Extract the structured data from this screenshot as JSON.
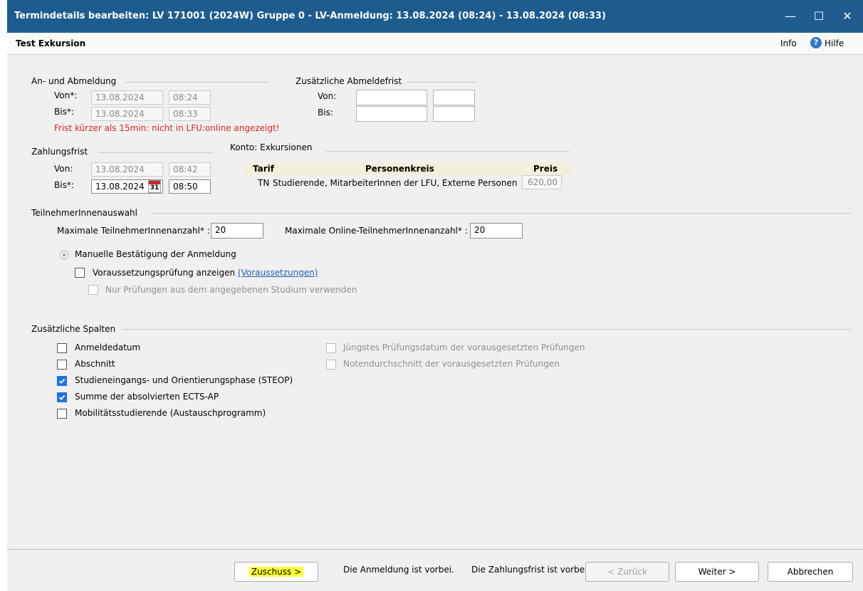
{
  "window": {
    "title": "Termindetails  bearbeiten:  LV 171001 (2024W)  Gruppe 0 - LV-Anmeldung: 13.08.2024 (08:24) - 13.08.2024 (08:33)",
    "minimize": "—",
    "maximize": "☐",
    "close": "✕",
    "bg_color": "#1e5b8e"
  },
  "header": {
    "title": "Test Exkursion",
    "info": "Info",
    "help": "Hilfe",
    "help_icon_glyph": "?"
  },
  "anmeldung": {
    "group_label": "An- und Abmeldung",
    "von_label": "Von*:",
    "von_date": "13.08.2024",
    "von_time": "08:24",
    "bis_label": "Bis*:",
    "bis_date": "13.08.2024",
    "bis_time": "08:33",
    "warning": "Frist kürzer als 15min: nicht in LFU:online angezeigt!"
  },
  "abmeldefrist": {
    "group_label": "Zusätzliche Abmeldefrist",
    "von_label": "Von:",
    "bis_label": "Bis:"
  },
  "zahlungsfrist": {
    "group_label": "Zahlungsfrist",
    "von_label": "Von:",
    "von_date": "13.08.2024",
    "von_time": "08:42",
    "bis_label": "Bis*:",
    "bis_date": "13.08.2024",
    "bis_time": "08:50",
    "calendar_day": "31"
  },
  "konto": {
    "label": "Konto: Exkursionen",
    "col_tarif": "Tarif",
    "col_personenkreis": "Personenkreis",
    "col_preis": "Preis",
    "row_tarif": "TN",
    "row_personenkreis": "Studierende, MitarbeiterInnen der LFU, Externe Personen",
    "row_preis": "620,00"
  },
  "teilnehmer": {
    "group_label": "TeilnehmerInnenauswahl",
    "max_label": "Maximale TeilnehmerInnenanzahl* :",
    "max_value": "20",
    "max_online_label": "Maximale Online-TeilnehmerInnenanzahl* :",
    "max_online_value": "20",
    "manual_label": "Manuelle Bestätigung der Anmeldung",
    "vorauss_label": "Voraussetzungsprüfung anzeigen",
    "vorauss_link": "(Voraussetzungen)",
    "nur_label": "Nur Prüfungen aus dem angegebenen Studium verwenden"
  },
  "spalten": {
    "group_label": "Zusätzliche Spalten",
    "anmeldedatum": "Anmeldedatum",
    "abschnitt": "Abschnitt",
    "steop": "Studieneingangs- und Orientierungsphase (STEOP)",
    "ects": "Summe der absolvierten ECTS-AP",
    "mobil": "Mobilitätsstudierende (Austauschprogramm)",
    "juengstes": "Jüngstes Prüfungsdatum der vorausgesetzten Prüfungen",
    "noten": "Notendurchschnitt der vorausgesetzten Prüfungen"
  },
  "footer": {
    "zuschuss": "Zuschuss >",
    "msg_anmeldung": "Die Anmeldung ist vorbei.",
    "msg_zahlung": "Die Zahlungsfrist ist vorbei.",
    "zurueck": "< Zurück",
    "weiter": "Weiter >",
    "abbrechen": "Abbrechen"
  }
}
